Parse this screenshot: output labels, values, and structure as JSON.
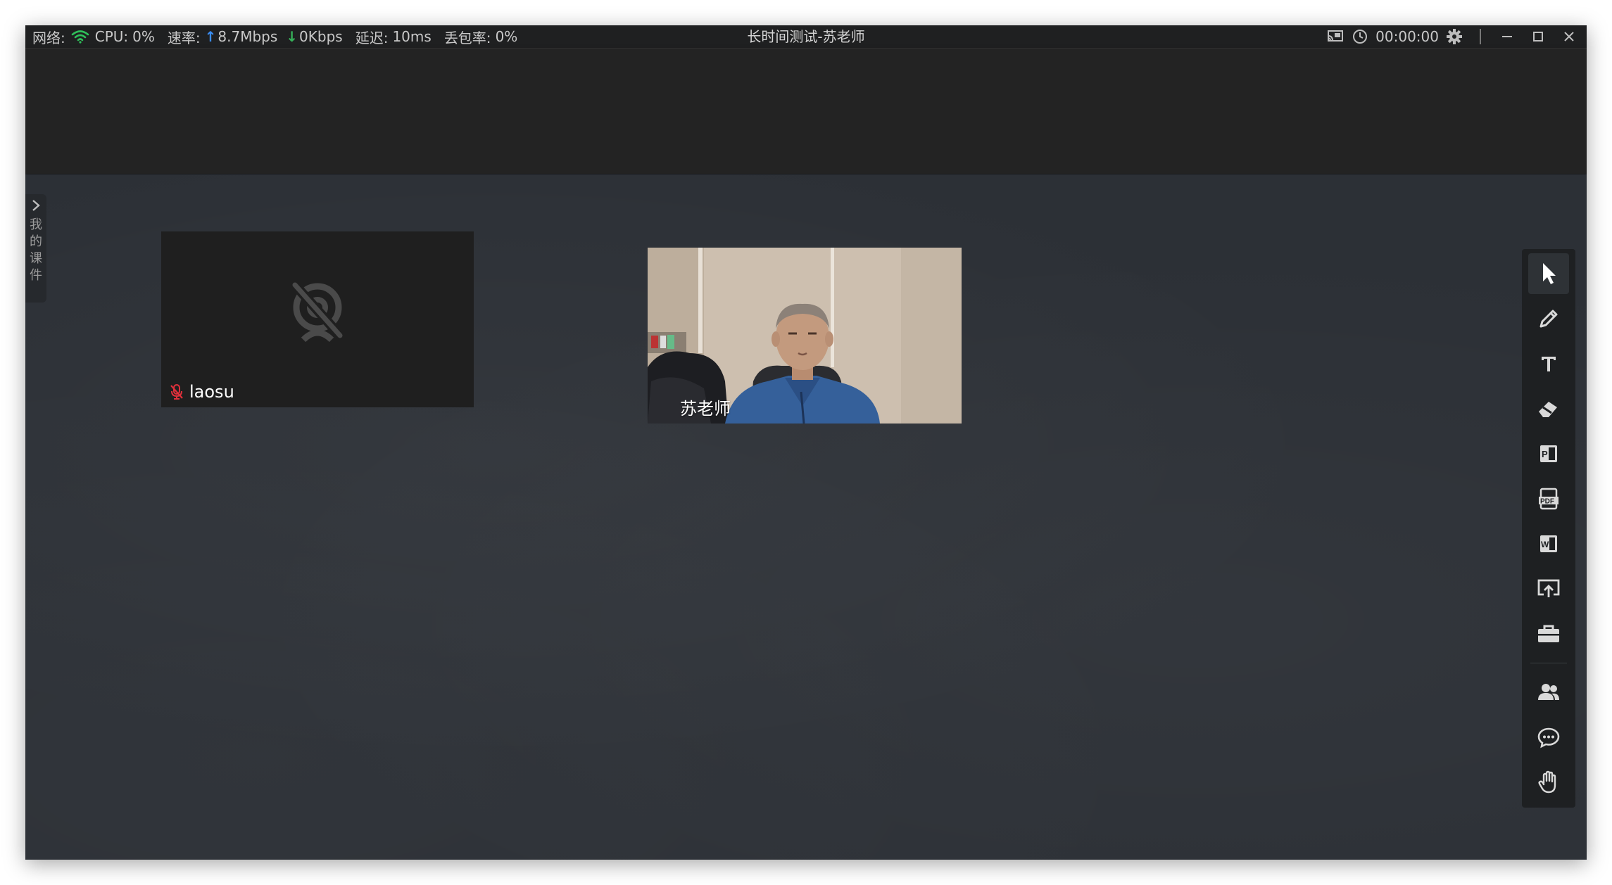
{
  "titlebar": {
    "network_label": "网络:",
    "cpu_label": "CPU:",
    "cpu_value": "0%",
    "rate_label": "速率:",
    "upload": "8.7Mbps",
    "download": "0Kbps",
    "latency_label": "延迟:",
    "latency_value": "10ms",
    "loss_label": "丢包率:",
    "loss_value": "0%",
    "window_title": "长时间测试-苏老师",
    "timer": "00:00:00"
  },
  "sidebar": {
    "courseware_label": "我的课件"
  },
  "participants": [
    {
      "name": "laosu",
      "camera": "off",
      "mic": "muted"
    },
    {
      "name": "苏老师",
      "camera": "on"
    }
  ],
  "toolbar": {
    "tools": [
      "pointer-icon",
      "pen-icon",
      "text-icon",
      "eraser-icon",
      "ppt-icon",
      "pdf-icon",
      "word-icon",
      "upload-screen-icon",
      "toolbox-icon",
      "members-icon",
      "chat-icon",
      "raise-hand-icon"
    ]
  },
  "colors": {
    "board": "#2c3036",
    "titlebar": "#1f2021",
    "upload_arrow": "#3a8ef6",
    "download_arrow": "#36b25a",
    "mic_muted": "#e0303b",
    "wifi": "#2fbf5a"
  }
}
